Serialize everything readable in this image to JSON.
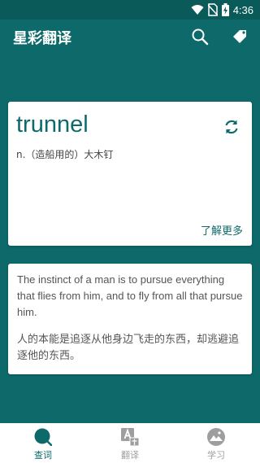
{
  "colors": {
    "primary": "#0e6a6a",
    "status_bar": "#0a5a5a",
    "card_background": "#ffffff",
    "inactive_nav": "#9e9e9e"
  },
  "status_bar": {
    "time": "4:36",
    "icons": [
      "wifi-icon",
      "no-sim-icon",
      "battery-charging-icon"
    ]
  },
  "app_bar": {
    "title": "星彩翻译",
    "actions": [
      "search-icon",
      "tag-icon"
    ]
  },
  "word_card": {
    "word": "trunnel",
    "definition": "n.（造船用的）大木钉",
    "action_icon": "refresh-icon",
    "learn_more": "了解更多"
  },
  "quote_card": {
    "english": "The instinct of a man is to pursue everything that flies from him, and to fly from all that pursue him.",
    "chinese": "人的本能是追逐从他身边飞走的东西，却逃避追逐他的东西。"
  },
  "bottom_nav": {
    "items": [
      {
        "label": "查词",
        "icon": "search-icon",
        "active": true
      },
      {
        "label": "翻译",
        "icon": "translate-icon",
        "active": false
      },
      {
        "label": "学习",
        "icon": "landscape-icon",
        "active": false
      }
    ]
  }
}
